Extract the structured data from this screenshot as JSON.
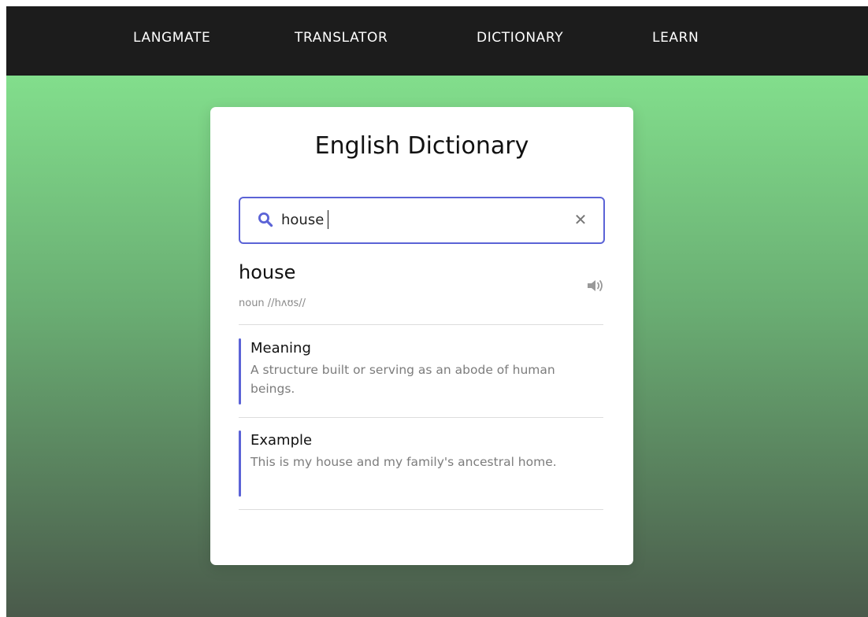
{
  "nav": {
    "items": [
      {
        "label": "LANGMATE"
      },
      {
        "label": "TRANSLATOR"
      },
      {
        "label": "DICTIONARY"
      },
      {
        "label": "LEARN"
      }
    ]
  },
  "dictionary": {
    "title": "English Dictionary",
    "search": {
      "value": "house",
      "search_icon": "search-icon",
      "clear_icon": "close-icon",
      "clear_symbol": "✕"
    },
    "entry": {
      "word": "house",
      "phonetic": "noun //hʌʊs//",
      "speaker_icon": "speaker-icon"
    },
    "meaning": {
      "title": "Meaning",
      "text": "A structure built or serving as an abode of human beings."
    },
    "example": {
      "title": "Example",
      "text": "This is my house and my family's ancestral home."
    }
  },
  "colors": {
    "accent": "#5b63d6",
    "navbar": "#1c1c1c",
    "gradient_top": "#82de8c",
    "gradient_bottom": "#4a5a4b"
  }
}
